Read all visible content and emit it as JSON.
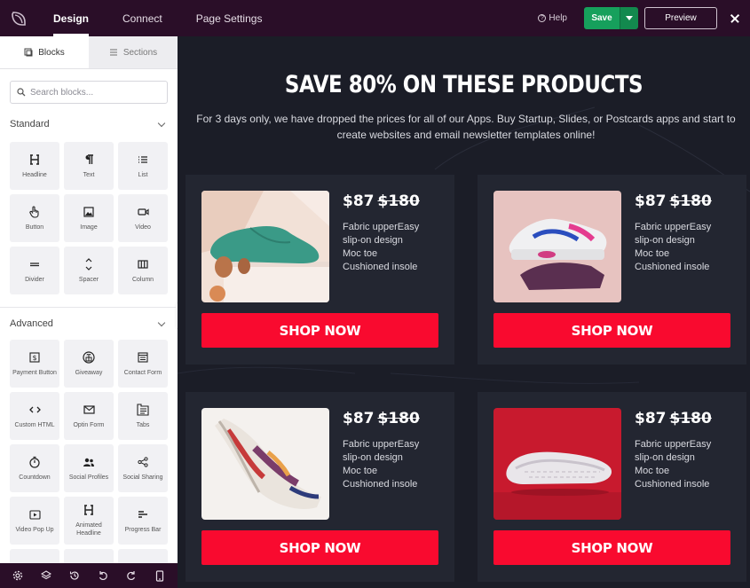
{
  "topbar": {
    "tabs": [
      {
        "label": "Design"
      },
      {
        "label": "Connect"
      },
      {
        "label": "Page Settings"
      }
    ],
    "help_label": "Help",
    "save_label": "Save",
    "preview_label": "Preview"
  },
  "sidebar": {
    "tabs": [
      {
        "label": "Blocks"
      },
      {
        "label": "Sections"
      }
    ],
    "search_placeholder": "Search blocks...",
    "standard": {
      "title": "Standard",
      "blocks": [
        {
          "label": "Headline",
          "icon": "headline-icon"
        },
        {
          "label": "Text",
          "icon": "paragraph-icon"
        },
        {
          "label": "List",
          "icon": "list-icon"
        },
        {
          "label": "Button",
          "icon": "pointer-icon"
        },
        {
          "label": "Image",
          "icon": "image-icon"
        },
        {
          "label": "Video",
          "icon": "video-icon"
        },
        {
          "label": "Divider",
          "icon": "divider-icon"
        },
        {
          "label": "Spacer",
          "icon": "spacer-icon"
        },
        {
          "label": "Column",
          "icon": "column-icon"
        }
      ]
    },
    "advanced": {
      "title": "Advanced",
      "blocks": [
        {
          "label": "Payment Button",
          "icon": "dollar-icon"
        },
        {
          "label": "Giveaway",
          "icon": "giveaway-icon"
        },
        {
          "label": "Contact Form",
          "icon": "form-icon"
        },
        {
          "label": "Custom HTML",
          "icon": "code-icon"
        },
        {
          "label": "Optin Form",
          "icon": "mail-icon"
        },
        {
          "label": "Tabs",
          "icon": "tabs-icon"
        },
        {
          "label": "Countdown",
          "icon": "stopwatch-icon"
        },
        {
          "label": "Social Profiles",
          "icon": "users-icon"
        },
        {
          "label": "Social Sharing",
          "icon": "share-icon"
        },
        {
          "label": "Video Pop Up",
          "icon": "video-popup-icon"
        },
        {
          "label": "Animated Headline",
          "icon": "headline-icon"
        },
        {
          "label": "Progress Bar",
          "icon": "progress-icon"
        }
      ]
    }
  },
  "canvas": {
    "headline": "SAVE 80% ON THESE PRODUCTS",
    "subtext": "For 3 days only, we have dropped the prices for all of our Apps. Buy Startup, Slides, or Postcards apps and start to create websites and email newsletter templates online!",
    "products": [
      {
        "price": "$87",
        "old_price": "$180",
        "features": [
          "Fabric upperEasy",
          "slip-on design",
          "Moc toe",
          "Cushioned insole"
        ],
        "button": "SHOP NOW"
      },
      {
        "price": "$87",
        "old_price": "$180",
        "features": [
          "Fabric upperEasy",
          "slip-on design",
          "Moc toe",
          "Cushioned insole"
        ],
        "button": "SHOP NOW"
      },
      {
        "price": "$87",
        "old_price": "$180",
        "features": [
          "Fabric upperEasy",
          "slip-on design",
          "Moc toe",
          "Cushioned insole"
        ],
        "button": "SHOP NOW"
      },
      {
        "price": "$87",
        "old_price": "$180",
        "features": [
          "Fabric upperEasy",
          "slip-on design",
          "Moc toe",
          "Cushioned insole"
        ],
        "button": "SHOP NOW"
      }
    ]
  },
  "colors": {
    "topbar": "#2a0e28",
    "save": "#16a05c",
    "canvas_bg": "#1b1d27",
    "card_bg": "#232631",
    "shop_button": "#f90a2f"
  }
}
